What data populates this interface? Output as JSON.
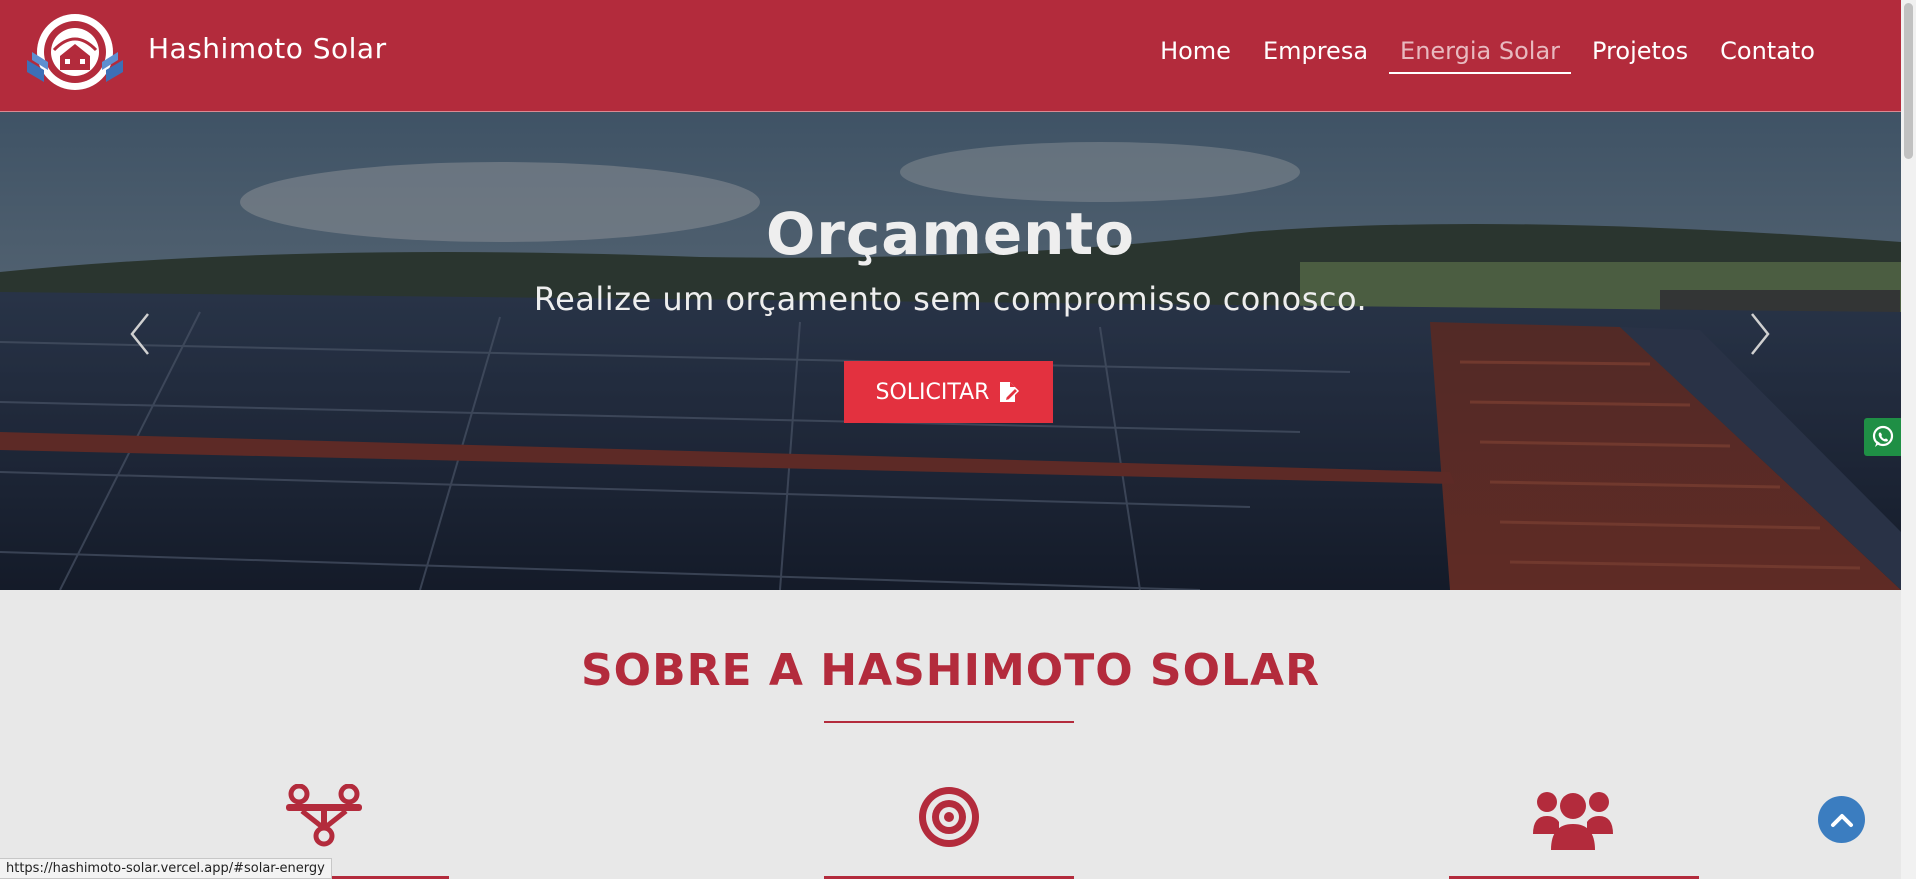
{
  "header": {
    "brand": "Hashimoto Solar",
    "nav": [
      {
        "label": "Home",
        "active": false
      },
      {
        "label": "Empresa",
        "active": false
      },
      {
        "label": "Energia Solar",
        "active": true
      },
      {
        "label": "Projetos",
        "active": false
      },
      {
        "label": "Contato",
        "active": false
      }
    ]
  },
  "hero": {
    "title": "Orçamento",
    "subtitle": "Realize um orçamento sem compromisso conosco.",
    "button_label": "SOLICITAR",
    "button_icon": "edit-document-icon",
    "prev_icon": "chevron-left-icon",
    "next_icon": "chevron-right-icon"
  },
  "about": {
    "title": "SOBRE A HASHIMOTO SOLAR",
    "features": [
      {
        "icon": "network-nodes-icon"
      },
      {
        "icon": "target-icon"
      },
      {
        "icon": "users-group-icon"
      }
    ]
  },
  "floating": {
    "whatsapp_icon": "whatsapp-icon",
    "back_to_top_icon": "chevron-up-icon"
  },
  "status_bar": {
    "url": "https://hashimoto-solar.vercel.app/#solar-energy"
  },
  "colors": {
    "brand_red": "#b32b3c",
    "button_red": "#e3313f",
    "whatsapp_green": "#1f8f45",
    "back_to_top_blue": "#3b7dc0",
    "section_bg": "#e8e8e8"
  }
}
